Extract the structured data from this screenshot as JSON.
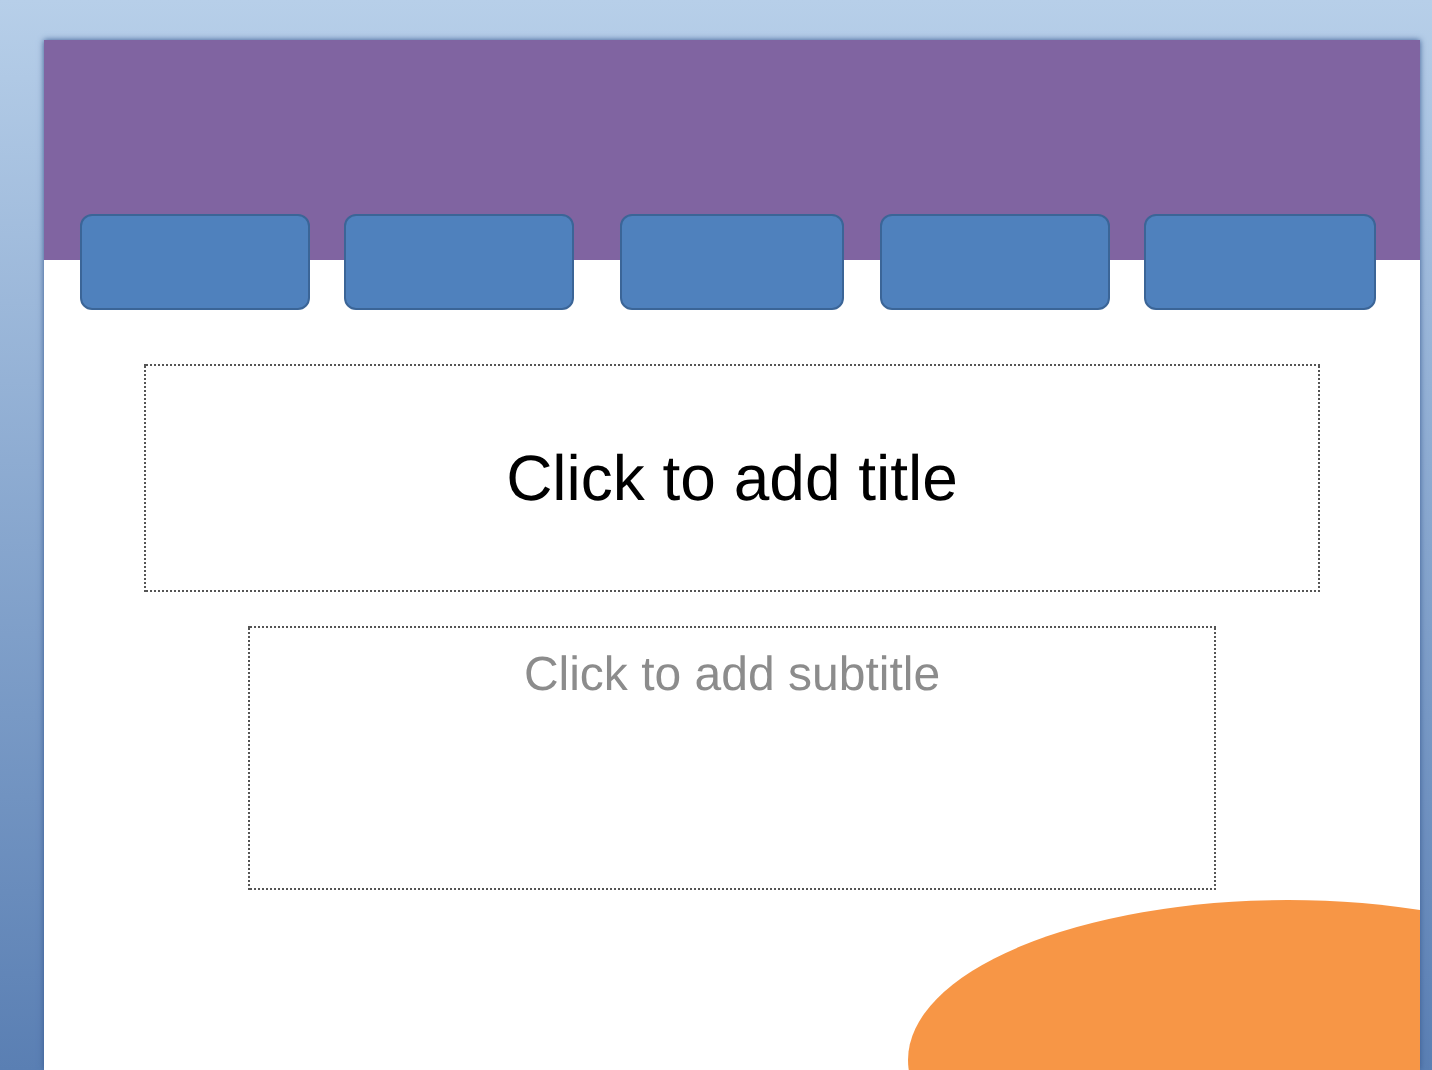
{
  "slide": {
    "title_placeholder": "Click to add title",
    "subtitle_placeholder": "Click to add subtitle"
  }
}
